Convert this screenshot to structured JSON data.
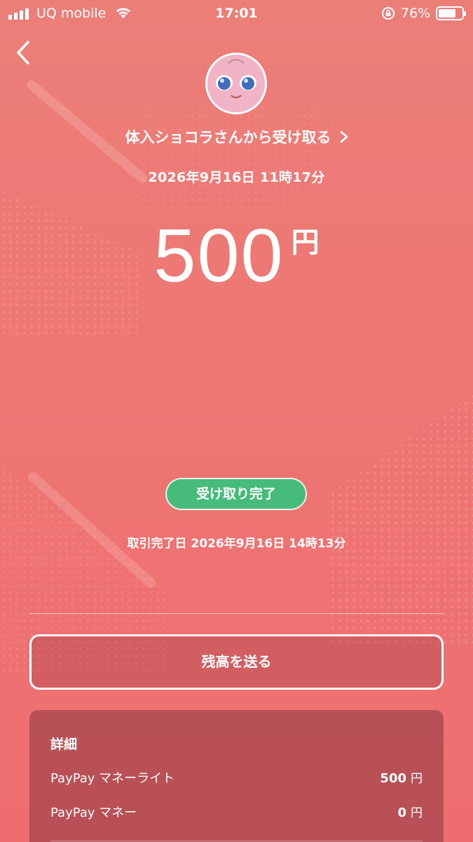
{
  "status_bar": {
    "carrier": "UQ mobile",
    "time": "17:01",
    "battery_percent": "76%",
    "battery_level": 0.76
  },
  "header": {
    "sender_text": "体入ショコラさんから受け取る",
    "date": "2026年9月16日 11時17分"
  },
  "amount": {
    "value": "500",
    "unit": "円"
  },
  "status": {
    "badge": "受け取り完了",
    "completed_date": "取引完了日 2026年9月16日 14時13分"
  },
  "actions": {
    "send_balance": "残高を送る"
  },
  "details": {
    "title": "詳細",
    "rows": [
      {
        "label": "PayPay マネーライト",
        "value": "500",
        "unit": "円"
      },
      {
        "label": "PayPay マネー",
        "value": "0",
        "unit": "円"
      }
    ]
  },
  "colors": {
    "background": "#ee7673",
    "badge": "#47bb7a",
    "text": "#ffffff"
  },
  "icons": [
    "signal-icon",
    "wifi-icon",
    "rotation-lock-icon",
    "battery-icon",
    "back-arrow-icon",
    "chevron-right-icon",
    "avatar"
  ]
}
